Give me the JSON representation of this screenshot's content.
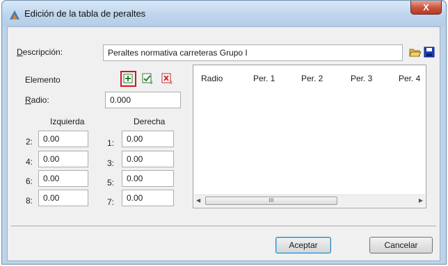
{
  "window": {
    "title": "Edición de la tabla de peraltes",
    "close_glyph": "X"
  },
  "descripcion": {
    "label_first": "D",
    "label_rest": "escripción:",
    "value": "Peraltes normativa carreteras Grupo I"
  },
  "toolbar": {
    "open_icon": "folder-open-icon",
    "save_icon": "save-icon"
  },
  "elemento": {
    "label": "Elemento",
    "icons": [
      "add-row-icon",
      "edit-row-icon",
      "delete-row-icon"
    ],
    "radio_label_first": "R",
    "radio_label_rest": "adio:",
    "radio_value": "0.000",
    "izquierda_label": "Izquierda",
    "derecha_label": "Derecha",
    "izquierda": [
      {
        "label": "2:",
        "value": "0.00"
      },
      {
        "label": "4:",
        "value": "0.00"
      },
      {
        "label": "6:",
        "value": "0.00"
      },
      {
        "label": "8:",
        "value": "0.00"
      }
    ],
    "derecha": [
      {
        "label": "1:",
        "value": "0.00"
      },
      {
        "label": "3:",
        "value": "0.00"
      },
      {
        "label": "5:",
        "value": "0.00"
      },
      {
        "label": "7:",
        "value": "0.00"
      }
    ]
  },
  "grid": {
    "columns": [
      "Radio",
      "Per. 1",
      "Per. 2",
      "Per. 3",
      "Per. 4"
    ],
    "scroll_grip": "III",
    "scroll_left": "◀",
    "scroll_right": "▶"
  },
  "buttons": {
    "accept": "Aceptar",
    "cancel": "Cancelar"
  },
  "colors": {
    "accent_red": "#d0181f",
    "title_gradient": "#bdd4ec"
  }
}
